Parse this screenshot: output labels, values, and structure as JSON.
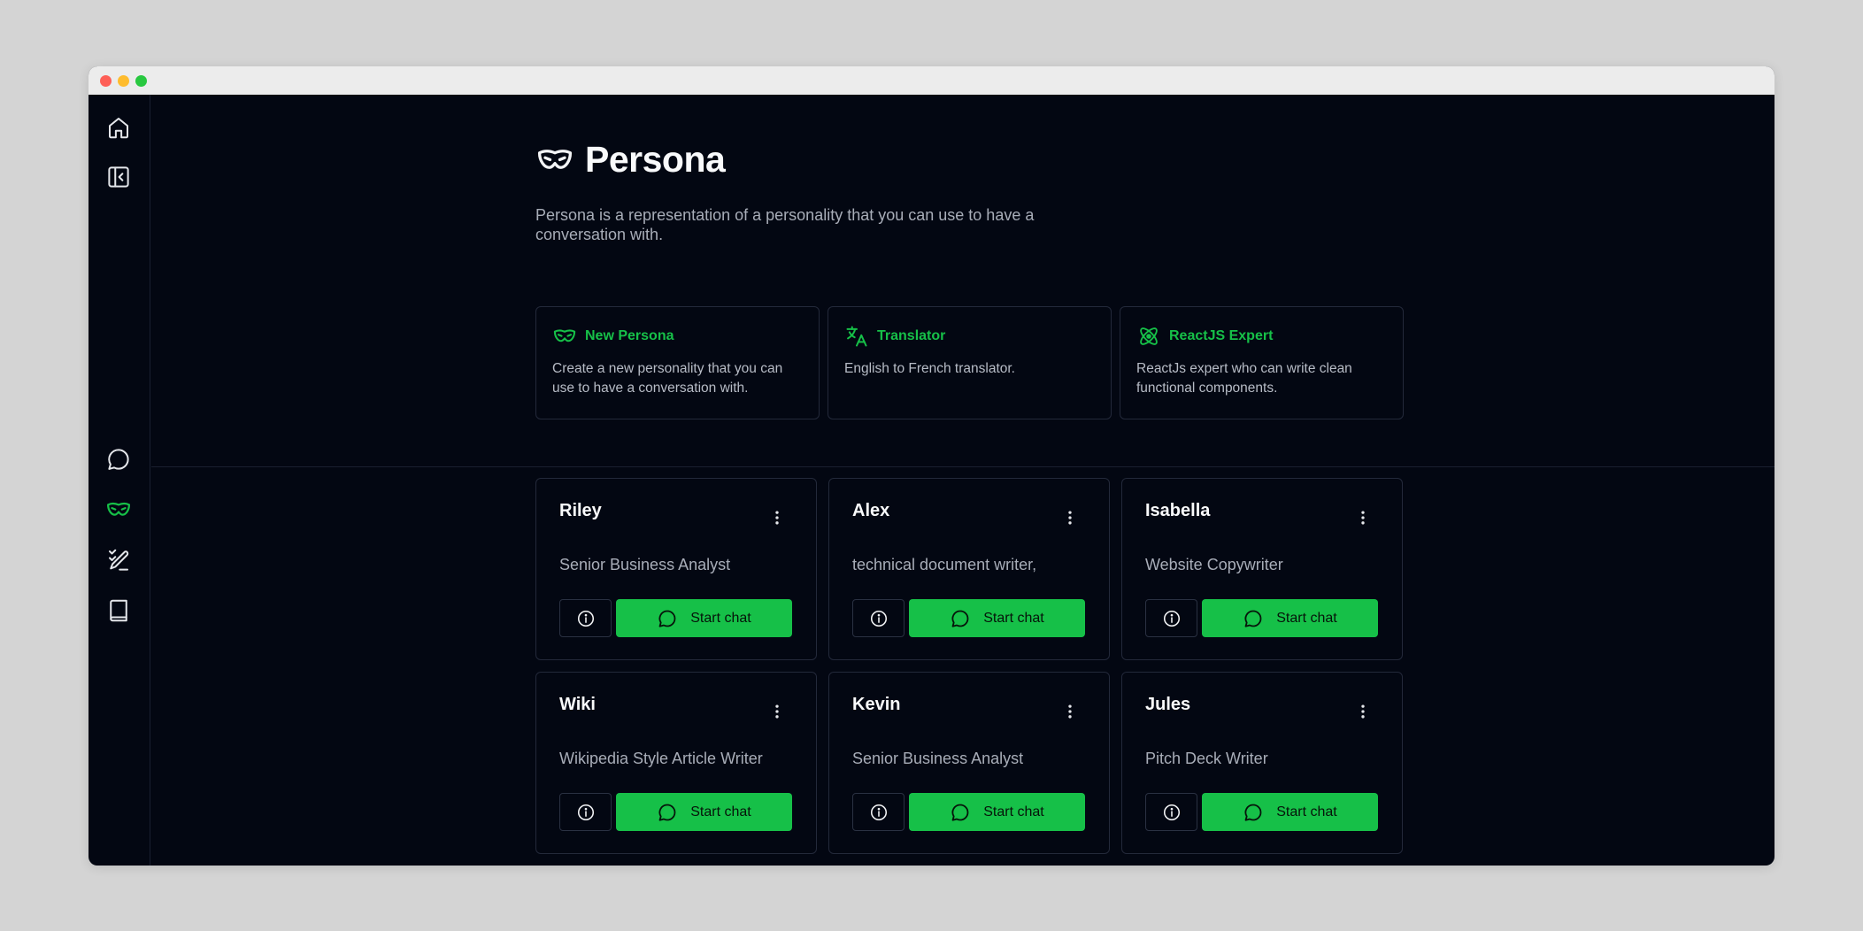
{
  "colors": {
    "background": "#030712",
    "accent": "#16c048",
    "text_primary": "#f9fafb",
    "text_secondary": "#a8adb8",
    "border": "#23293a"
  },
  "sidebar": {
    "top_items": [
      {
        "icon": "home-icon"
      },
      {
        "icon": "sidebar-collapse-icon"
      }
    ],
    "bottom_items": [
      {
        "icon": "chat-bubble-icon",
        "active": false
      },
      {
        "icon": "mask-icon",
        "active": true
      },
      {
        "icon": "prompt-pen-icon",
        "active": false
      },
      {
        "icon": "book-icon",
        "active": false
      }
    ]
  },
  "header": {
    "title": "Persona",
    "icon": "mask-icon",
    "description": "Persona is a representation of a personality that you can use to have a conversation with."
  },
  "templates": [
    {
      "name": "New Persona",
      "icon": "mask-icon",
      "description": "Create a new personality that you can use to have a conversation with."
    },
    {
      "name": "Translator",
      "icon": "translate-icon",
      "description": "English to French translator."
    },
    {
      "name": "ReactJS Expert",
      "icon": "atom-icon",
      "description": "ReactJs expert who can write clean functional components."
    }
  ],
  "personas": [
    {
      "name": "Riley",
      "role": "Senior Business Analyst"
    },
    {
      "name": "Alex",
      "role": "technical document writer,"
    },
    {
      "name": "Isabella",
      "role": "Website Copywriter"
    },
    {
      "name": "Wiki",
      "role": "Wikipedia Style Article Writer"
    },
    {
      "name": "Kevin",
      "role": "Senior Business Analyst"
    },
    {
      "name": "Jules",
      "role": "Pitch Deck Writer"
    }
  ],
  "actions": {
    "start_chat_label": "Start chat"
  }
}
